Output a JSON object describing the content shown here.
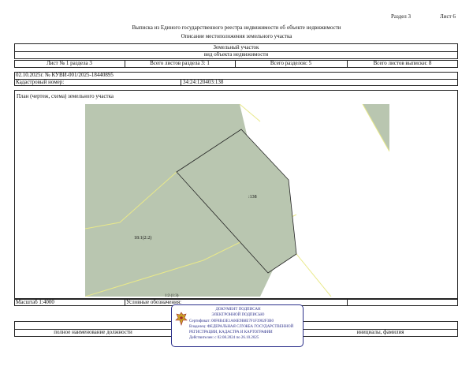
{
  "header": {
    "section": "Раздел 3",
    "sheet": "Лист 6",
    "title": "Выписка из Единого государственного реестра недвижимости об объекте недвижимости",
    "subtitle": "Описание местоположения земельного участка"
  },
  "object": {
    "type": "Земельный участок",
    "type_caption": "вид объекта недвижимости"
  },
  "sheet_info": {
    "sheet_of_section": "Лист № 1 раздела 3",
    "total_sheets_section": "Всего листов раздела 3: 1",
    "total_sections": "Всего разделов: 5",
    "total_sheets_extract": "Всего листов выписки: 8"
  },
  "extract": {
    "date_number": "02.10.2025г. № КУВИ-001/2025-18440895",
    "cadastral_label": "Кадастровый номер:",
    "cadastral_number": "34:24:120403:138"
  },
  "plan": {
    "caption": "План (чертеж, схема) земельного участка",
    "parcel_label": ":138",
    "neighbor_label": "18:1(2:2)",
    "bottom_label": "1:2 (1:3)",
    "colors": {
      "land": "#b9c6b0",
      "outline": "#e9e98a",
      "border": "#222222"
    }
  },
  "footer": {
    "scale": "Масштаб 1:4000",
    "legend_label": "Условные обозначения:",
    "position_label": "полное наименование должности",
    "initials_label": "инициалы, фамилия"
  },
  "stamp": {
    "line1": "ДОКУМЕНТ ПОДПИСАН",
    "line2": "ЭЛЕКТРОННОЙ ПОДПИСЬЮ",
    "cert": "Сертификат: 00F8B43E1A66E9B8E7F1F3902F3B0",
    "owner": "Владелец: ФЕДЕРАЛЬНАЯ СЛУЖБА ГОСУДАРСТВЕННОЙ",
    "owner2": "РЕГИСТРАЦИИ, КАДАСТРА И КАРТОГРАФИИ",
    "valid": "Действителен: с 02.08.2024 по 26.10.2025",
    "emblem": "eagle-emblem-icon"
  }
}
